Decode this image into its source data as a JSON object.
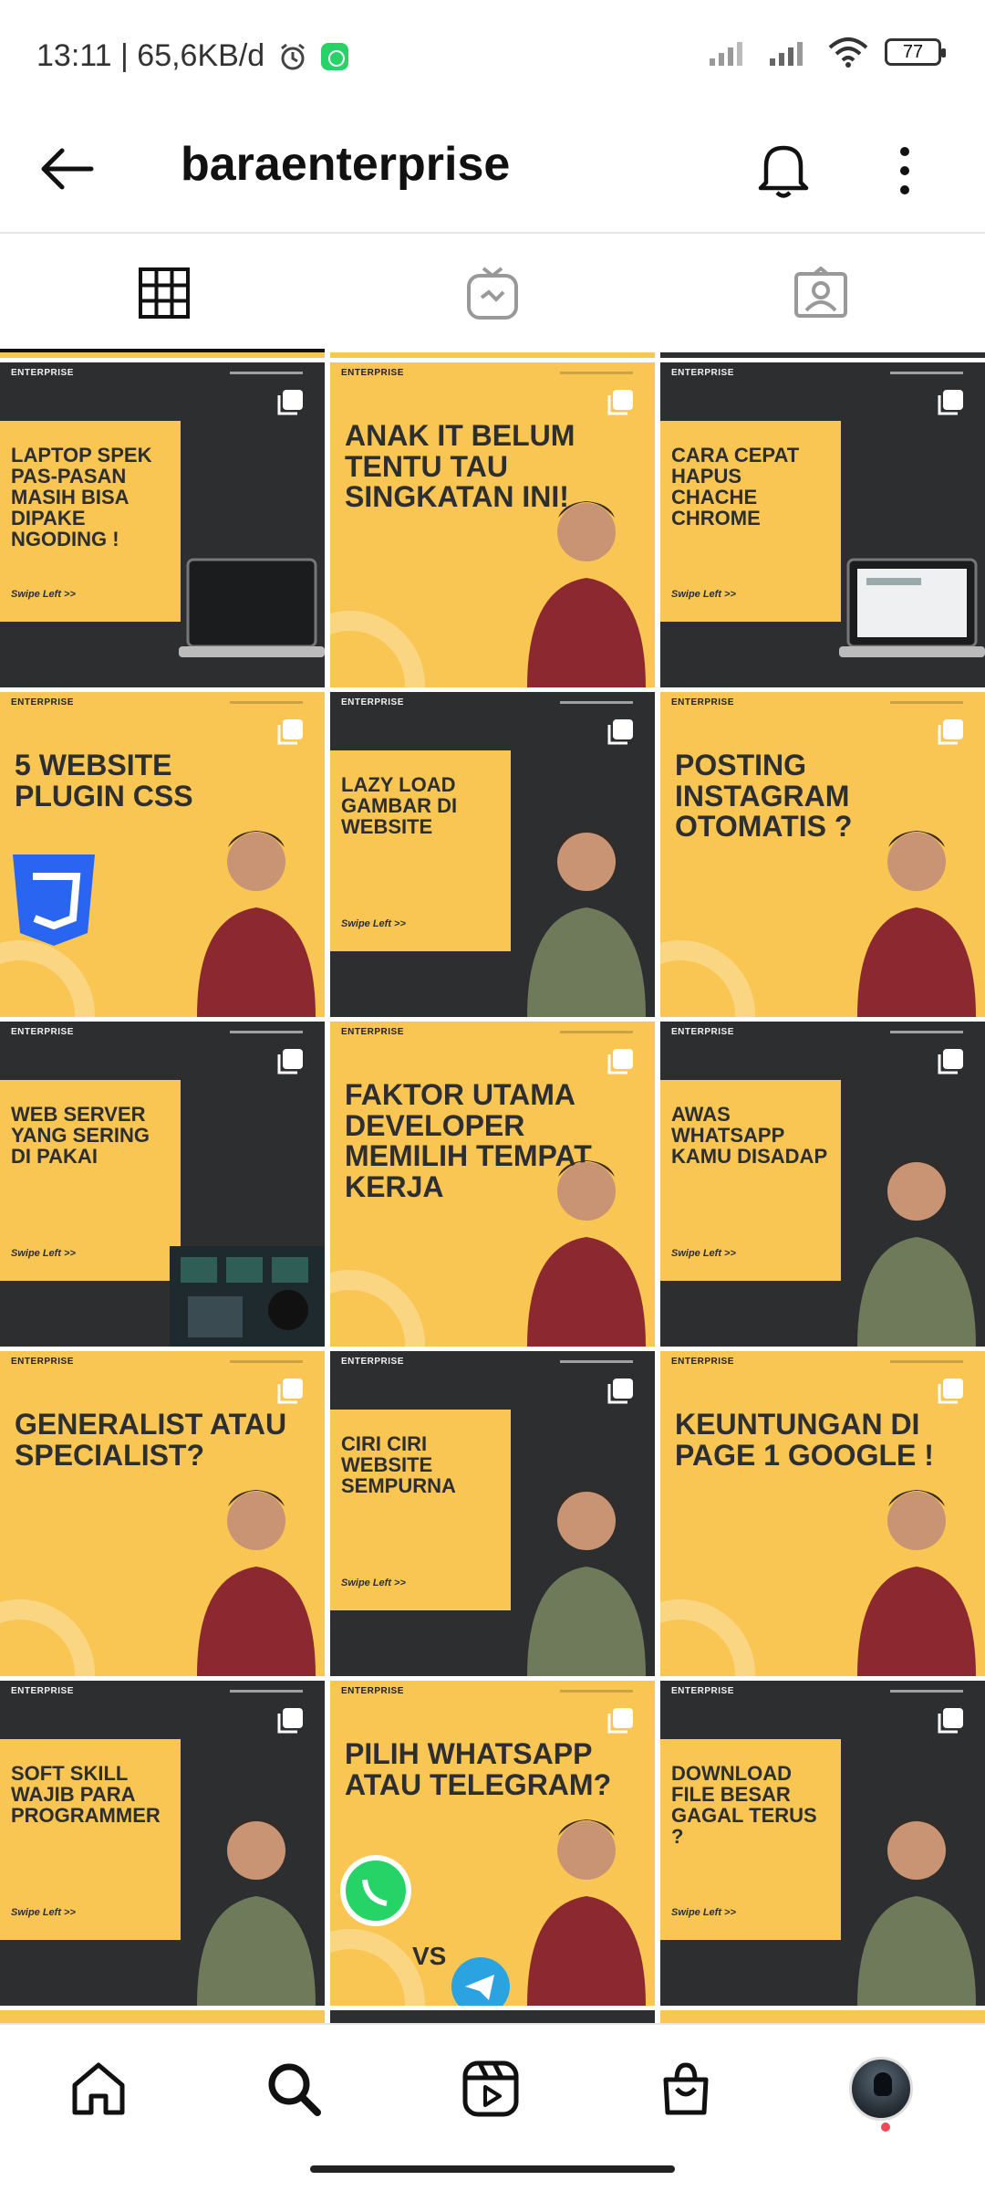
{
  "status_bar": {
    "time_speed": "13:11 | 65,6KB/d",
    "battery": "77",
    "icons": [
      "alarm-icon",
      "whatsapp-icon",
      "signal-icon",
      "signal-icon",
      "wifi-icon",
      "battery-icon"
    ]
  },
  "header": {
    "username": "baraenterprise",
    "icons": [
      "back-arrow-icon",
      "bell-icon",
      "more-vertical-icon"
    ]
  },
  "tabs": [
    {
      "name": "grid",
      "icon": "grid-icon",
      "active": true
    },
    {
      "name": "igtv",
      "icon": "igtv-icon",
      "active": false
    },
    {
      "name": "tagged",
      "icon": "tagged-icon",
      "active": false
    }
  ],
  "brand_label": "ENTERPRISE",
  "swipe_text": "Swipe Left >>",
  "posts": [
    {
      "title": "LAPTOP SPEK PAS-PASAN MASIH BISA DIPAKE NGODING !",
      "theme": "dark",
      "figure": "laptop"
    },
    {
      "title": "ANAK IT BELUM TENTU TAU SINGKATAN INI!",
      "theme": "yellow",
      "figure": "person"
    },
    {
      "title": "CARA CEPAT HAPUS CHACHE CHROME",
      "theme": "dark",
      "figure": "laptop-photo"
    },
    {
      "title": "5 WEBSITE PLUGIN CSS",
      "theme": "yellow",
      "figure": "person-css"
    },
    {
      "title": "LAZY LOAD GAMBAR DI WEBSITE",
      "theme": "dark",
      "figure": "person"
    },
    {
      "title": "POSTING INSTAGRAM OTOMATIS ?",
      "theme": "yellow",
      "figure": "person"
    },
    {
      "title": "WEB SERVER YANG SERING DI PAKAI",
      "theme": "dark",
      "figure": "server-photo"
    },
    {
      "title": "FAKTOR UTAMA DEVELOPER MEMILIH TEMPAT KERJA",
      "theme": "yellow",
      "figure": "person"
    },
    {
      "title": "AWAS WHATSAPP KAMU DISADAP",
      "theme": "dark",
      "figure": "person"
    },
    {
      "title": "GENERALIST ATAU SPECIALIST?",
      "theme": "yellow",
      "figure": "person"
    },
    {
      "title": "CIRI CIRI WEBSITE SEMPURNA",
      "theme": "dark",
      "figure": "person"
    },
    {
      "title": "KEUNTUNGAN DI PAGE 1 GOOGLE !",
      "theme": "yellow",
      "figure": "person"
    },
    {
      "title": "SOFT SKILL WAJIB PARA PROGRAMMER",
      "theme": "dark",
      "figure": "person"
    },
    {
      "title": "PILIH WHATSAPP ATAU TELEGRAM?",
      "theme": "yellow",
      "figure": "person-vs",
      "vs_text": "VS"
    },
    {
      "title": "DOWNLOAD FILE BESAR GAGAL TERUS ?",
      "theme": "dark",
      "figure": "person"
    }
  ],
  "bottom_nav": [
    {
      "name": "home",
      "icon": "home-icon"
    },
    {
      "name": "search",
      "icon": "search-icon"
    },
    {
      "name": "reels",
      "icon": "reels-icon"
    },
    {
      "name": "shop",
      "icon": "shop-icon"
    },
    {
      "name": "profile",
      "icon": "profile-avatar"
    }
  ],
  "colors": {
    "accent_yellow": "#f9c654",
    "dark_panel": "#2d2e30",
    "notification_dot": "#ed4956"
  }
}
